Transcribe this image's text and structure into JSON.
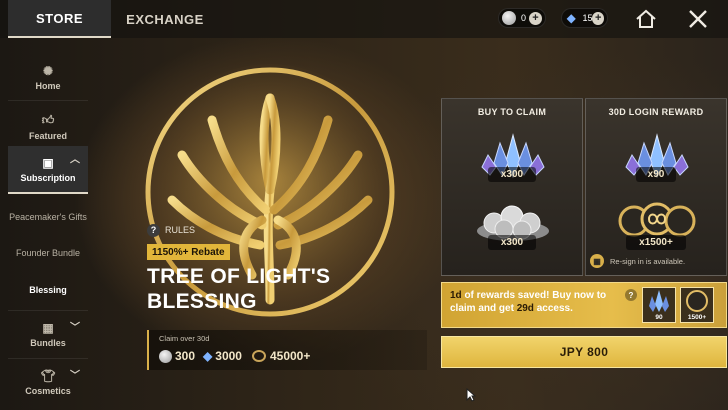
{
  "tabs": {
    "store": "STORE",
    "exchange": "EXCHANGE"
  },
  "currencies": [
    {
      "icon": "silver-coin-icon",
      "value": "0"
    },
    {
      "icon": "crystal-icon",
      "value": "15"
    }
  ],
  "sidebar": {
    "items": [
      {
        "label": "Home",
        "icon": "sparkle-icon"
      },
      {
        "label": "Featured",
        "icon": "thumbs-up-icon"
      },
      {
        "label": "Subscription",
        "icon": "bookmark-icon"
      },
      {
        "label": "Peacemaker's Gifts"
      },
      {
        "label": "Founder Bundle"
      },
      {
        "label": "Blessing"
      },
      {
        "label": "Bundles",
        "icon": "box-icon"
      },
      {
        "label": "Cosmetics",
        "icon": "shirt-icon"
      }
    ]
  },
  "offer": {
    "rules_label": "RULES",
    "rebate": "1150%+ Rebate",
    "title": "TREE OF LIGHT'S BLESSING",
    "claim_label": "Claim over 30d",
    "claim_values": {
      "coins": "300",
      "crystals": "3000",
      "rings": "45000+"
    }
  },
  "cards": {
    "buy": {
      "title": "BUY TO CLAIM",
      "crystal_qty": "x300",
      "coin_qty": "x300"
    },
    "login": {
      "title": "30D LOGIN REWARD",
      "crystal_qty": "x90",
      "ring_qty": "x1500+",
      "note": "Re-sign in is available."
    }
  },
  "saved_banner": {
    "days_saved": "1d",
    "text_a": " of rewards saved! Buy now to claim and get ",
    "days_access": "29d",
    "text_b": " access.",
    "mini_values": [
      "90",
      "1500+"
    ]
  },
  "price": "JPY 800",
  "colors": {
    "accent_gold": "#e2b63a",
    "crystal_blue": "#7fb3ff"
  }
}
